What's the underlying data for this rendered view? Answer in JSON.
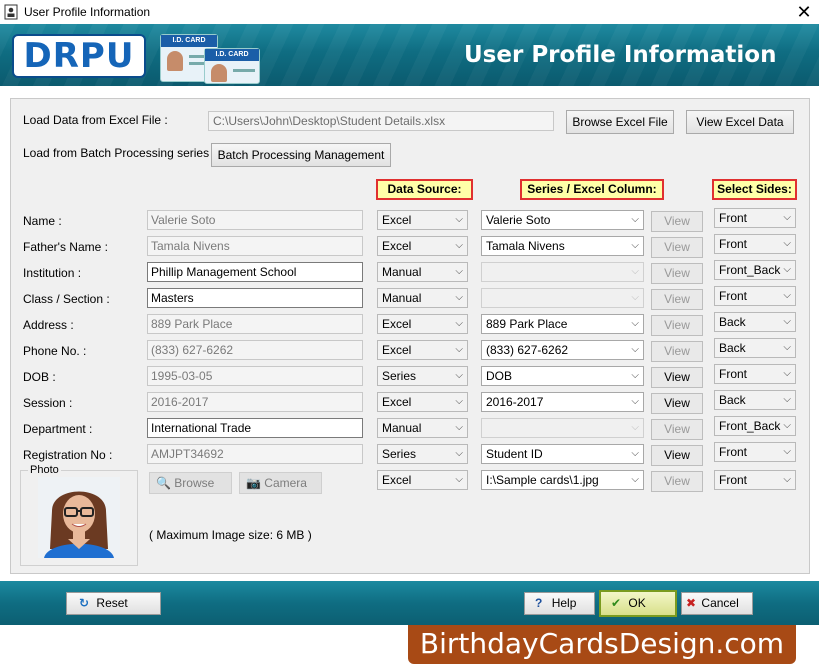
{
  "window": {
    "title": "User Profile Information",
    "close_glyph": "✕"
  },
  "header": {
    "logo_text": "DRPU",
    "title": "User Profile Information",
    "card_label": "I.D. CARD"
  },
  "load_excel": {
    "label": "Load Data from Excel File :",
    "path": "C:\\Users\\John\\Desktop\\Student Details.xlsx",
    "browse_label": "Browse Excel File",
    "view_label": "View Excel Data"
  },
  "batch": {
    "label": "Load from Batch Processing series :",
    "button_label": "Batch Processing Management"
  },
  "column_headers": {
    "data_source": "Data Source:",
    "series_column": "Series / Excel Column:",
    "select_sides": "Select Sides:"
  },
  "rows": [
    {
      "label": "Name :",
      "value": "Valerie Soto",
      "editable": false,
      "source": "Excel",
      "column": "Valerie Soto",
      "column_enabled": true,
      "view_enabled": false,
      "side": "Front"
    },
    {
      "label": "Father's Name :",
      "value": "Tamala Nivens",
      "editable": false,
      "source": "Excel",
      "column": "Tamala Nivens",
      "column_enabled": true,
      "view_enabled": false,
      "side": "Front"
    },
    {
      "label": "Institution :",
      "value": "Phillip Management School",
      "editable": true,
      "source": "Manual",
      "column": "",
      "column_enabled": false,
      "view_enabled": false,
      "side": "Front_Back"
    },
    {
      "label": "Class / Section :",
      "value": "Masters",
      "editable": true,
      "source": "Manual",
      "column": "",
      "column_enabled": false,
      "view_enabled": false,
      "side": "Front"
    },
    {
      "label": "Address :",
      "value": "889 Park Place",
      "editable": false,
      "source": "Excel",
      "column": "889 Park Place",
      "column_enabled": true,
      "view_enabled": false,
      "side": "Back"
    },
    {
      "label": "Phone No. :",
      "value": "(833) 627-6262",
      "editable": false,
      "source": "Excel",
      "column": "(833) 627-6262",
      "column_enabled": true,
      "view_enabled": false,
      "side": "Back"
    },
    {
      "label": "DOB :",
      "value": "1995-03-05",
      "editable": false,
      "source": "Series",
      "column": "DOB",
      "column_enabled": true,
      "view_enabled": true,
      "side": "Front"
    },
    {
      "label": "Session :",
      "value": "2016-2017",
      "editable": false,
      "source": "Excel",
      "column": "2016-2017",
      "column_enabled": true,
      "view_enabled": true,
      "side": "Back"
    },
    {
      "label": "Department :",
      "value": "International Trade",
      "editable": true,
      "source": "Manual",
      "column": "",
      "column_enabled": false,
      "view_enabled": false,
      "side": "Front_Back"
    },
    {
      "label": "Registration No :",
      "value": "AMJPT34692",
      "editable": false,
      "source": "Series",
      "column": "Student ID",
      "column_enabled": true,
      "view_enabled": true,
      "side": "Front"
    }
  ],
  "view_label": "View",
  "photo": {
    "label": "Photo",
    "browse_label": "Browse",
    "camera_label": "Camera",
    "source": "Excel",
    "column": "I:\\Sample cards\\1.jpg",
    "view_enabled": false,
    "side": "Front",
    "max_size_note": "( Maximum Image size: 6 MB )"
  },
  "footer": {
    "reset_label": "Reset",
    "help_label": "Help",
    "ok_label": "OK",
    "cancel_label": "Cancel"
  },
  "brand_text": "BirthdayCardsDesign.com",
  "colors": {
    "banner": "#0f6d82",
    "tag_bg": "#ffffa8",
    "tag_border": "#e03030",
    "brand_bg": "#a84a15"
  }
}
